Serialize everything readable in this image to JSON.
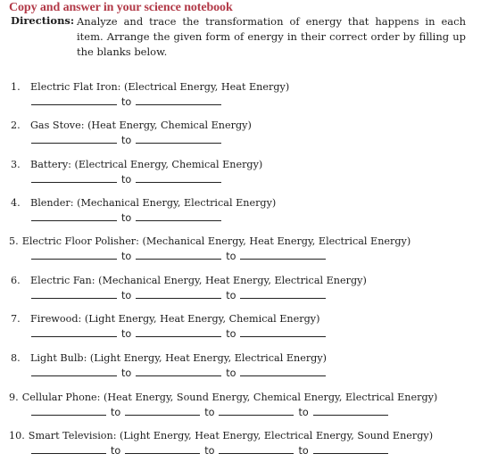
{
  "heading": "Copy and answer in your science notebook",
  "directions": {
    "label": "Directions:",
    "text": "Analyze and trace the transformation of energy that happens in each item. Arrange the given form of energy in their correct order by filling up the blanks below."
  },
  "connector": "to",
  "accent_color": "#b23a48",
  "items": [
    {
      "number": "1.",
      "text": "Electric Flat Iron: (Electrical Energy, Heat Energy)",
      "blanks": 2
    },
    {
      "number": "2.",
      "text": "Gas Stove: (Heat Energy, Chemical Energy)",
      "blanks": 2
    },
    {
      "number": "3.",
      "text": "Battery: (Electrical Energy, Chemical Energy)",
      "blanks": 2
    },
    {
      "number": "4.",
      "text": "Blender: (Mechanical Energy, Electrical Energy)",
      "blanks": 2
    },
    {
      "number": "5.",
      "text": "Electric Floor Polisher: (Mechanical Energy, Heat Energy, Electrical Energy)",
      "blanks": 3
    },
    {
      "number": "6.",
      "text": "Electric Fan: (Mechanical Energy, Heat Energy, Electrical Energy)",
      "blanks": 3
    },
    {
      "number": "7.",
      "text": "Firewood: (Light Energy, Heat Energy, Chemical Energy)",
      "blanks": 3
    },
    {
      "number": "8.",
      "text": "Light Bulb: (Light Energy, Heat Energy, Electrical Energy)",
      "blanks": 3
    },
    {
      "number": "9.",
      "text": "Cellular Phone: (Heat Energy, Sound Energy, Chemical Energy, Electrical Energy)",
      "blanks": 4
    },
    {
      "number": "10.",
      "text": "Smart Television: (Light Energy, Heat Energy, Electrical Energy, Sound Energy)",
      "blanks": 4
    }
  ]
}
